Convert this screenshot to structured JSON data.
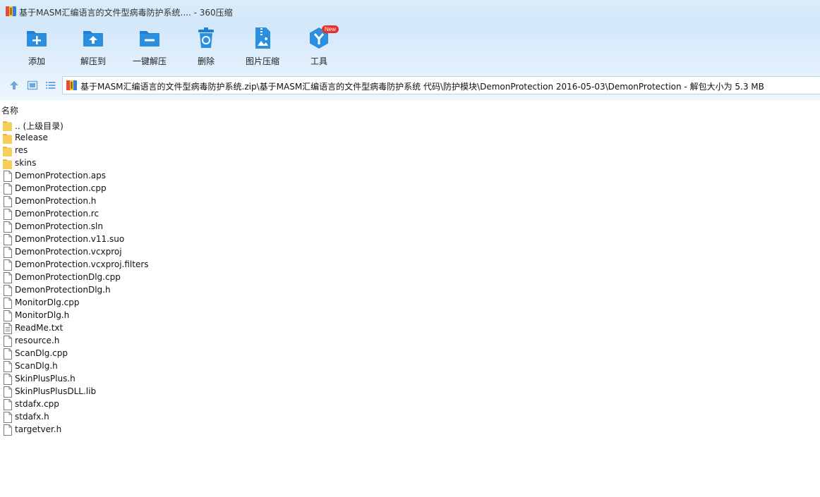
{
  "window": {
    "title": "基于MASM汇编语言的文件型病毒防护系统.... - 360压缩"
  },
  "toolbar": {
    "items": [
      {
        "label": "添加",
        "icon": "folder-add-icon"
      },
      {
        "label": "解压到",
        "icon": "folder-extract-icon"
      },
      {
        "label": "一键解压",
        "icon": "folder-minus-icon"
      },
      {
        "label": "删除",
        "icon": "recycle-bin-icon"
      },
      {
        "label": "图片压缩",
        "icon": "image-compress-icon"
      },
      {
        "label": "工具",
        "icon": "tools-icon",
        "badge": "New"
      }
    ]
  },
  "address": {
    "path": "基于MASM汇编语言的文件型病毒防护系统.zip\\基于MASM汇编语言的文件型病毒防护系统 代码\\防护模块\\DemonProtection 2016-05-03\\DemonProtection - 解包大小为 5.3 MB"
  },
  "list": {
    "column_name": "名称",
    "items": [
      {
        "name": ".. (上级目录)",
        "type": "folder"
      },
      {
        "name": "Release",
        "type": "folder"
      },
      {
        "name": "res",
        "type": "folder"
      },
      {
        "name": "skins",
        "type": "folder"
      },
      {
        "name": "DemonProtection.aps",
        "type": "file"
      },
      {
        "name": "DemonProtection.cpp",
        "type": "file"
      },
      {
        "name": "DemonProtection.h",
        "type": "file"
      },
      {
        "name": "DemonProtection.rc",
        "type": "file"
      },
      {
        "name": "DemonProtection.sln",
        "type": "file"
      },
      {
        "name": "DemonProtection.v11.suo",
        "type": "file"
      },
      {
        "name": "DemonProtection.vcxproj",
        "type": "file"
      },
      {
        "name": "DemonProtection.vcxproj.filters",
        "type": "file"
      },
      {
        "name": "DemonProtectionDlg.cpp",
        "type": "file"
      },
      {
        "name": "DemonProtectionDlg.h",
        "type": "file"
      },
      {
        "name": "MonitorDlg.cpp",
        "type": "file"
      },
      {
        "name": "MonitorDlg.h",
        "type": "file"
      },
      {
        "name": "ReadMe.txt",
        "type": "text"
      },
      {
        "name": "resource.h",
        "type": "file"
      },
      {
        "name": "ScanDlg.cpp",
        "type": "file"
      },
      {
        "name": "ScanDlg.h",
        "type": "file"
      },
      {
        "name": "SkinPlusPlus.h",
        "type": "file"
      },
      {
        "name": "SkinPlusPlusDLL.lib",
        "type": "file"
      },
      {
        "name": "stdafx.cpp",
        "type": "file"
      },
      {
        "name": "stdafx.h",
        "type": "file"
      },
      {
        "name": "targetver.h",
        "type": "file"
      }
    ]
  },
  "colors": {
    "accent": "#2b8fe0",
    "folder": "#f6cf5b",
    "badge": "#e8302a"
  }
}
